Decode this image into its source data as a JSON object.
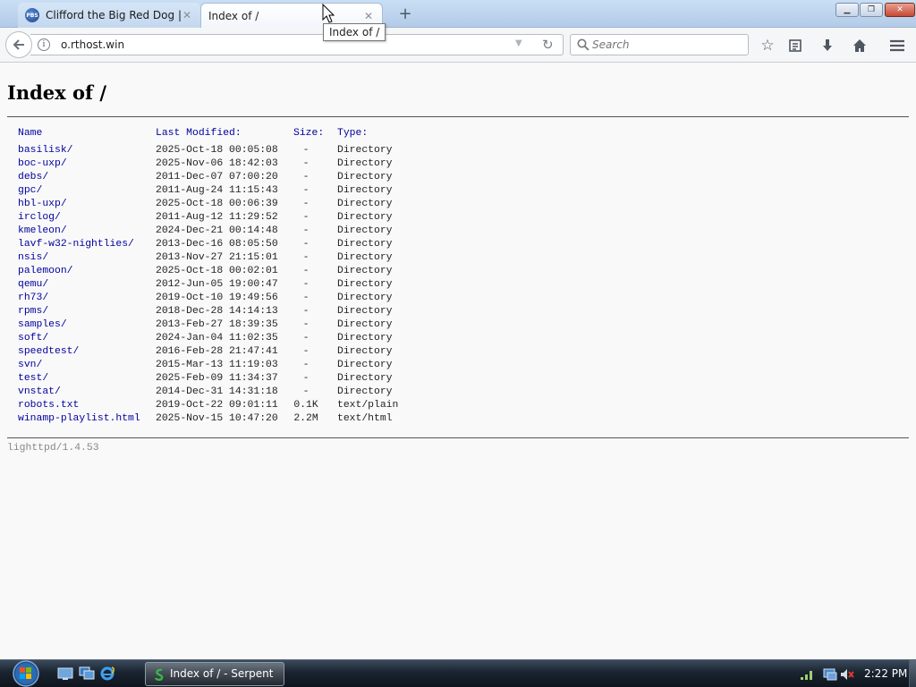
{
  "browser": {
    "tabs": [
      {
        "label": "Clifford the Big Red Dog | PB",
        "favicon_text": "PBS",
        "active": false
      },
      {
        "label": "Index of /",
        "active": true
      }
    ],
    "tooltip": "Index of /",
    "url": "o.rthost.win",
    "search_placeholder": "Search",
    "window_controls": {
      "minimize": "▁",
      "maximize": "❐",
      "close": "✕"
    },
    "nav_icons": [
      "back-icon",
      "info-icon",
      "reload-icon",
      "search-icon",
      "bookmark-star-icon",
      "reading-list-icon",
      "download-icon",
      "home-icon",
      "menu-icon"
    ]
  },
  "page": {
    "title": "Index of /",
    "headers": {
      "name": "Name",
      "modified": "Last Modified:",
      "size": "Size:",
      "type": "Type:"
    },
    "entries": [
      {
        "name": "basilisk/",
        "modified": "2025-Oct-18 00:05:08",
        "size": "-",
        "type": "Directory"
      },
      {
        "name": "boc-uxp/",
        "modified": "2025-Nov-06 18:42:03",
        "size": "-",
        "type": "Directory"
      },
      {
        "name": "debs/",
        "modified": "2011-Dec-07 07:00:20",
        "size": "-",
        "type": "Directory"
      },
      {
        "name": "gpc/",
        "modified": "2011-Aug-24 11:15:43",
        "size": "-",
        "type": "Directory"
      },
      {
        "name": "hbl-uxp/",
        "modified": "2025-Oct-18 00:06:39",
        "size": "-",
        "type": "Directory"
      },
      {
        "name": "irclog/",
        "modified": "2011-Aug-12 11:29:52",
        "size": "-",
        "type": "Directory"
      },
      {
        "name": "kmeleon/",
        "modified": "2024-Dec-21 00:14:48",
        "size": "-",
        "type": "Directory"
      },
      {
        "name": "lavf-w32-nightlies/",
        "modified": "2013-Dec-16 08:05:50",
        "size": "-",
        "type": "Directory"
      },
      {
        "name": "nsis/",
        "modified": "2013-Nov-27 21:15:01",
        "size": "-",
        "type": "Directory"
      },
      {
        "name": "palemoon/",
        "modified": "2025-Oct-18 00:02:01",
        "size": "-",
        "type": "Directory"
      },
      {
        "name": "qemu/",
        "modified": "2012-Jun-05 19:00:47",
        "size": "-",
        "type": "Directory"
      },
      {
        "name": "rh73/",
        "modified": "2019-Oct-10 19:49:56",
        "size": "-",
        "type": "Directory"
      },
      {
        "name": "rpms/",
        "modified": "2018-Dec-28 14:14:13",
        "size": "-",
        "type": "Directory"
      },
      {
        "name": "samples/",
        "modified": "2013-Feb-27 18:39:35",
        "size": "-",
        "type": "Directory"
      },
      {
        "name": "soft/",
        "modified": "2024-Jan-04 11:02:35",
        "size": "-",
        "type": "Directory"
      },
      {
        "name": "speedtest/",
        "modified": "2016-Feb-28 21:47:41",
        "size": "-",
        "type": "Directory"
      },
      {
        "name": "svn/",
        "modified": "2015-Mar-13 11:19:03",
        "size": "-",
        "type": "Directory"
      },
      {
        "name": "test/",
        "modified": "2025-Feb-09 11:34:37",
        "size": "-",
        "type": "Directory"
      },
      {
        "name": "vnstat/",
        "modified": "2014-Dec-31 14:31:18",
        "size": "-",
        "type": "Directory"
      },
      {
        "name": "robots.txt",
        "modified": "2019-Oct-22 09:01:11",
        "size": "0.1K",
        "type": "text/plain"
      },
      {
        "name": "winamp-playlist.html",
        "modified": "2025-Nov-15 10:47:20",
        "size": "2.2M",
        "type": "text/html"
      }
    ],
    "footer": "lighttpd/1.4.53"
  },
  "taskbar": {
    "task_label": "Index of / - Serpent",
    "clock": "2:22 PM",
    "tray_icons": [
      "network-icon",
      "display-icon",
      "volume-muted-icon"
    ]
  }
}
